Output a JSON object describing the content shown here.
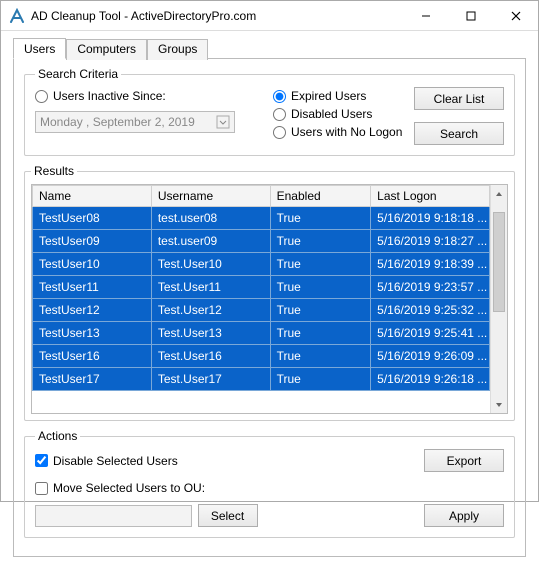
{
  "window": {
    "title": "AD Cleanup Tool - ActiveDirectoryPro.com"
  },
  "tabs": {
    "users": "Users",
    "computers": "Computers",
    "groups": "Groups"
  },
  "criteria": {
    "legend": "Search Criteria",
    "inactive_label": "Users Inactive Since:",
    "date_value": "Monday  , September  2, 2019",
    "expired_label": "Expired Users",
    "disabled_label": "Disabled Users",
    "nologon_label": "Users with No Logon",
    "clear_btn": "Clear List",
    "search_btn": "Search"
  },
  "results": {
    "legend": "Results",
    "headers": {
      "name": "Name",
      "username": "Username",
      "enabled": "Enabled",
      "lastlogon": "Last Logon"
    },
    "rows": [
      {
        "name": "TestUser08",
        "username": "test.user08",
        "enabled": "True",
        "lastlogon": "5/16/2019 9:18:18 ..."
      },
      {
        "name": "TestUser09",
        "username": "test.user09",
        "enabled": "True",
        "lastlogon": "5/16/2019 9:18:27 ..."
      },
      {
        "name": "TestUser10",
        "username": "Test.User10",
        "enabled": "True",
        "lastlogon": "5/16/2019 9:18:39 ..."
      },
      {
        "name": "TestUser11",
        "username": "Test.User11",
        "enabled": "True",
        "lastlogon": "5/16/2019 9:23:57 ..."
      },
      {
        "name": "TestUser12",
        "username": "Test.User12",
        "enabled": "True",
        "lastlogon": "5/16/2019 9:25:32 ..."
      },
      {
        "name": "TestUser13",
        "username": "Test.User13",
        "enabled": "True",
        "lastlogon": "5/16/2019 9:25:41 ..."
      },
      {
        "name": "TestUser16",
        "username": "Test.User16",
        "enabled": "True",
        "lastlogon": "5/16/2019 9:26:09 ..."
      },
      {
        "name": "TestUser17",
        "username": "Test.User17",
        "enabled": "True",
        "lastlogon": "5/16/2019 9:26:18 ..."
      }
    ]
  },
  "actions": {
    "legend": "Actions",
    "disable_label": "Disable Selected Users",
    "move_label": "Move Selected Users to OU:",
    "export_btn": "Export",
    "select_btn": "Select",
    "apply_btn": "Apply"
  }
}
